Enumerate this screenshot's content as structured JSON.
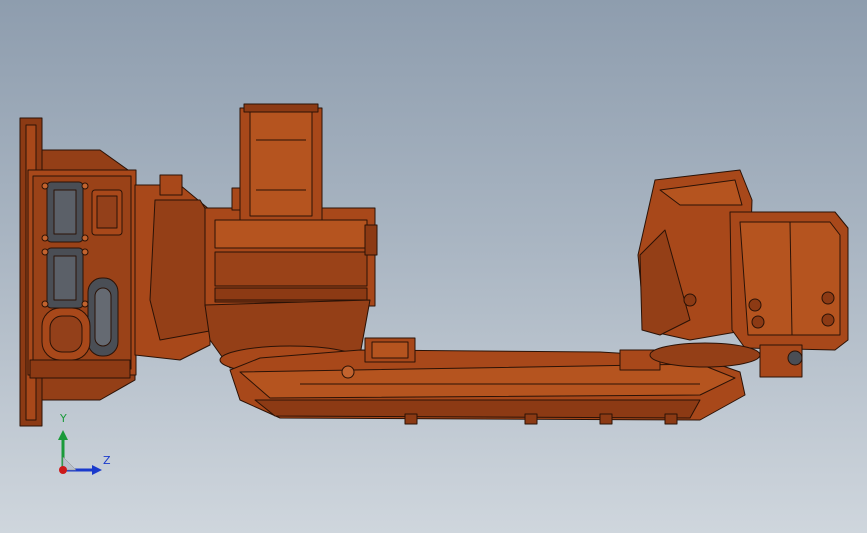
{
  "viewport": {
    "background_top": "#8e9dae",
    "background_bottom": "#cfd6dd"
  },
  "model": {
    "body_color": "#a8481a",
    "shade_color": "#7a3410",
    "highlight_color": "#c2632e",
    "edge_color": "#2b1206",
    "connector_color": "#4a4e55"
  },
  "triad": {
    "y_label": "Y",
    "z_label": "Z",
    "y_color": "#1a9a3a",
    "z_color": "#1a3acc",
    "origin_color": "#cc1a1a"
  }
}
